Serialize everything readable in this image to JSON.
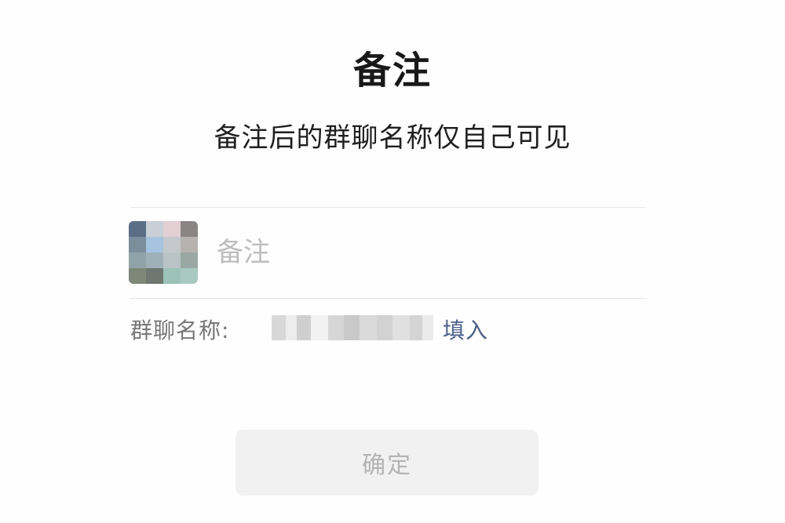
{
  "dialog": {
    "title": "备注",
    "subtitle": "备注后的群聊名称仅自己可见"
  },
  "remark": {
    "placeholder": "备注",
    "value": ""
  },
  "group_name": {
    "label": "群聊名称:",
    "fill_label": "填入"
  },
  "confirm": {
    "label": "确定"
  }
}
